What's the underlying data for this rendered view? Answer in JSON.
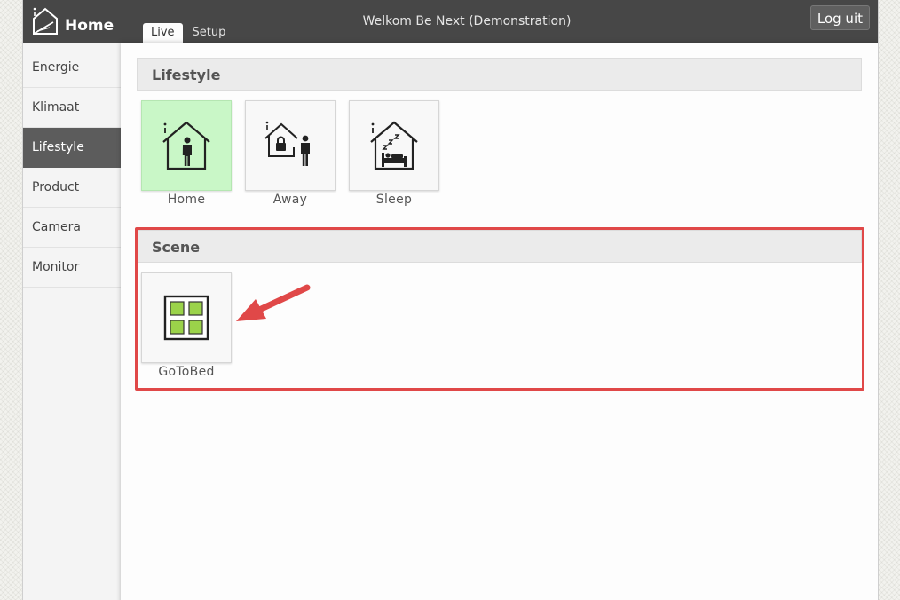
{
  "header": {
    "title": "Home",
    "welcome": "Welkom Be Next (Demonstration)",
    "logout_label": "Log uit",
    "tabs": [
      {
        "label": "Live",
        "active": true
      },
      {
        "label": "Setup",
        "active": false
      }
    ]
  },
  "sidebar": {
    "items": [
      {
        "label": "Energie"
      },
      {
        "label": "Klimaat"
      },
      {
        "label": "Lifestyle",
        "active": true
      },
      {
        "label": "Product"
      },
      {
        "label": "Camera"
      },
      {
        "label": "Monitor"
      }
    ]
  },
  "lifestyle": {
    "title": "Lifestyle",
    "tiles": [
      {
        "label": "Home",
        "icon": "house-person-icon",
        "selected": true
      },
      {
        "label": "Away",
        "icon": "house-lock-away-icon"
      },
      {
        "label": "Sleep",
        "icon": "house-sleep-icon"
      }
    ]
  },
  "scene": {
    "title": "Scene",
    "tiles": [
      {
        "label": "GoToBed",
        "icon": "scene-grid-icon"
      }
    ]
  },
  "colors": {
    "topbar": "#474747",
    "selected_tile": "#c9f7c7",
    "highlight": "#e04848",
    "scene_green": "#9bd34a"
  }
}
